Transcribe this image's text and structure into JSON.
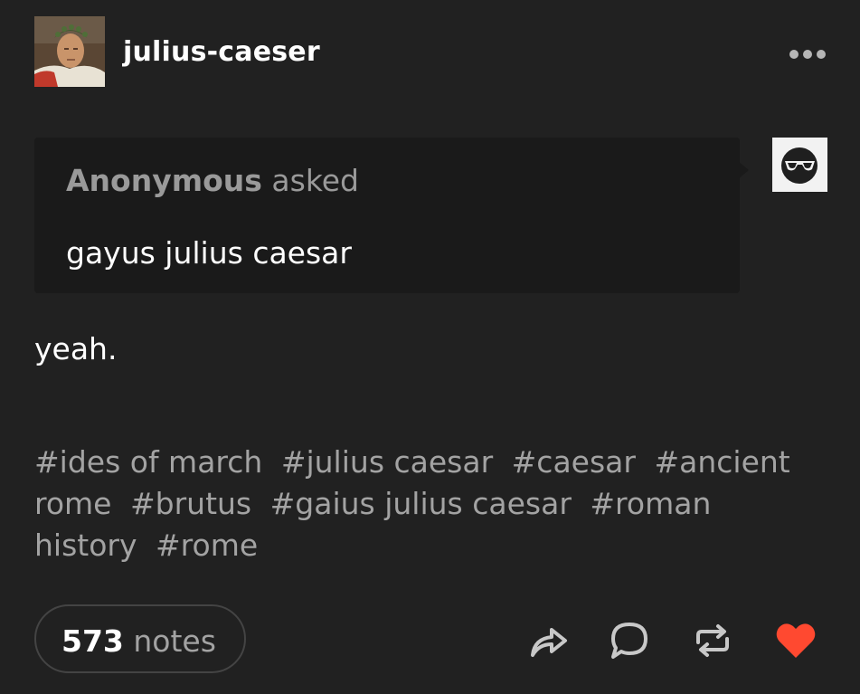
{
  "post": {
    "blog_name": "julius-caeser",
    "asker_name": "Anonymous",
    "asked_label": "asked",
    "question": "gayus julius caesar",
    "answer": "yeah.",
    "tags": [
      "#ides of march",
      "#julius caesar",
      "#caesar",
      "#ancient rome",
      "#brutus",
      "#gaius julius caesar",
      "#roman history",
      "#rome"
    ],
    "notes_count": "573",
    "notes_label": "notes"
  },
  "icons": {
    "more": "more-icon",
    "share": "share-icon",
    "reply": "reply-icon",
    "reblog": "reblog-icon",
    "like": "heart-icon"
  },
  "colors": {
    "background": "#212121",
    "ask_background": "#1a1a1a",
    "tag_text": "#a3a3a3",
    "heart": "#ff4930"
  }
}
